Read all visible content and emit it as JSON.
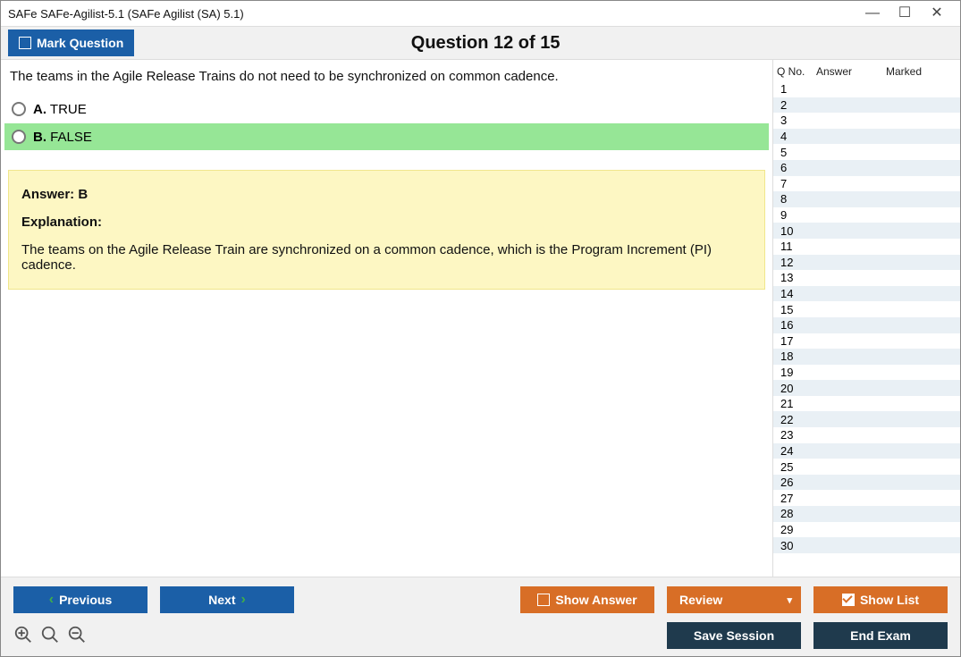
{
  "window": {
    "title": "SAFe SAFe-Agilist-5.1 (SAFe Agilist (SA) 5.1)"
  },
  "toolbar": {
    "mark_question": "Mark Question",
    "question_header": "Question 12 of 15"
  },
  "question": {
    "text": "The teams in the Agile Release Trains do not need to be synchronized on common cadence.",
    "options": [
      {
        "letter": "A.",
        "text": "TRUE",
        "correct": false
      },
      {
        "letter": "B.",
        "text": "FALSE",
        "correct": true
      }
    ],
    "answer_label": "Answer:",
    "answer_value": "B",
    "explanation_label": "Explanation:",
    "explanation_text": "The teams on the Agile Release Train are synchronized on a common cadence, which is the Program Increment (PI) cadence."
  },
  "side": {
    "headers": {
      "qno": "Q No.",
      "answer": "Answer",
      "marked": "Marked"
    },
    "rows": [
      {
        "n": "1"
      },
      {
        "n": "2"
      },
      {
        "n": "3"
      },
      {
        "n": "4"
      },
      {
        "n": "5"
      },
      {
        "n": "6"
      },
      {
        "n": "7"
      },
      {
        "n": "8"
      },
      {
        "n": "9"
      },
      {
        "n": "10"
      },
      {
        "n": "11"
      },
      {
        "n": "12"
      },
      {
        "n": "13"
      },
      {
        "n": "14"
      },
      {
        "n": "15"
      },
      {
        "n": "16"
      },
      {
        "n": "17"
      },
      {
        "n": "18"
      },
      {
        "n": "19"
      },
      {
        "n": "20"
      },
      {
        "n": "21"
      },
      {
        "n": "22"
      },
      {
        "n": "23"
      },
      {
        "n": "24"
      },
      {
        "n": "25"
      },
      {
        "n": "26"
      },
      {
        "n": "27"
      },
      {
        "n": "28"
      },
      {
        "n": "29"
      },
      {
        "n": "30"
      }
    ]
  },
  "footer": {
    "previous": "Previous",
    "next": "Next",
    "show_answer": "Show Answer",
    "review": "Review",
    "show_list": "Show List",
    "save_session": "Save Session",
    "end_exam": "End Exam"
  }
}
